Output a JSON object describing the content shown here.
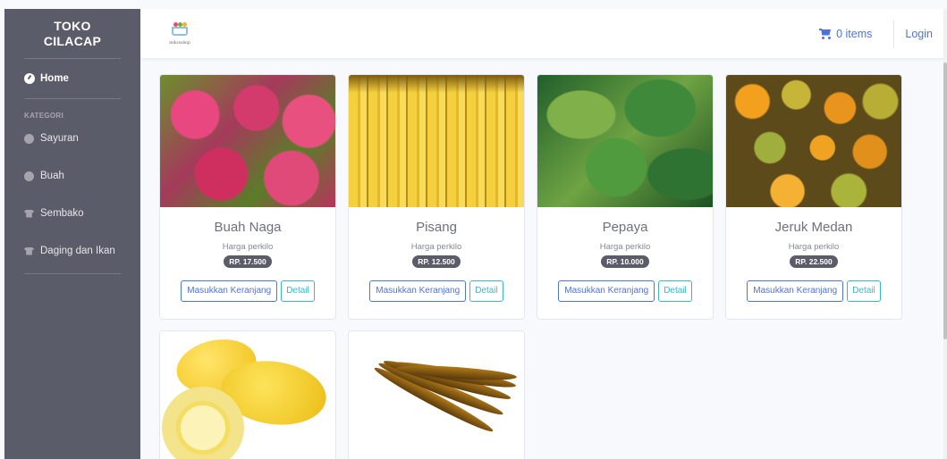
{
  "sidebar": {
    "brand": "TOKO CILACAP",
    "home": {
      "label": "Home",
      "icon": "dashboard-icon"
    },
    "heading": "KATEGORI",
    "items": [
      {
        "label": "Sayuran",
        "icon": "circle-icon"
      },
      {
        "label": "Buah",
        "icon": "circle-icon"
      },
      {
        "label": "Sembako",
        "icon": "shirt-icon"
      },
      {
        "label": "Daging dan Ikan",
        "icon": "shirt-icon"
      }
    ]
  },
  "topbar": {
    "logo_text": "mikroshop",
    "cart_label": "0 items",
    "login_label": "Login"
  },
  "products": [
    {
      "name": "Buah Naga",
      "sub": "Harga perkilo",
      "price": "RP. 17.500",
      "cart_btn": "Masukkan Keranjang",
      "detail_btn": "Detail"
    },
    {
      "name": "Pisang",
      "sub": "Harga perkilo",
      "price": "RP. 12.500",
      "cart_btn": "Masukkan Keranjang",
      "detail_btn": "Detail"
    },
    {
      "name": "Pepaya",
      "sub": "Harga perkilo",
      "price": "RP. 10.000",
      "cart_btn": "Masukkan Keranjang",
      "detail_btn": "Detail"
    },
    {
      "name": "Jeruk Medan",
      "sub": "Harga perkilo",
      "price": "RP. 22.500",
      "cart_btn": "Masukkan Keranjang",
      "detail_btn": "Detail"
    }
  ],
  "colors": {
    "sidebar": "#5a5c69",
    "primary": "#4e73df",
    "info": "#36b9cc"
  }
}
